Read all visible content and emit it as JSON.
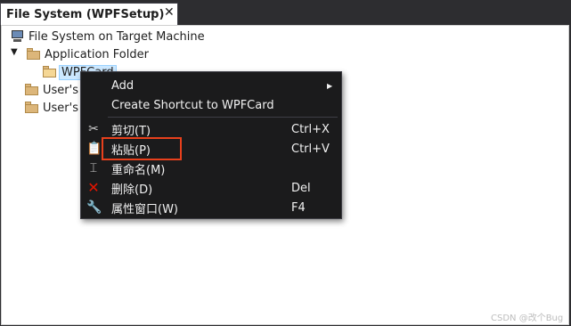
{
  "panel": {
    "title": "File System (WPFSetup)",
    "pin_glyph": "⊸",
    "close_glyph": "✕"
  },
  "tree": {
    "root": "File System on Target Machine",
    "app_folder": "Application Folder",
    "selected_item": "WPFCard",
    "user_folder_1": "User's",
    "user_folder_2": "User's"
  },
  "context_menu": {
    "items": [
      {
        "label": "Add",
        "shortcut": "",
        "icon": "none",
        "submenu": true
      },
      {
        "label": "Create Shortcut to WPFCard",
        "shortcut": "",
        "icon": "none"
      },
      {
        "label": "剪切(T)",
        "shortcut": "Ctrl+X",
        "icon": "scissors-icon"
      },
      {
        "label": "粘贴(P)",
        "shortcut": "Ctrl+V",
        "icon": "paste-icon"
      },
      {
        "label": "重命名(M)",
        "shortcut": "",
        "icon": "rename-icon"
      },
      {
        "label": "删除(D)",
        "shortcut": "Del",
        "icon": "delete-icon"
      },
      {
        "label": "属性窗口(W)",
        "shortcut": "F4",
        "icon": "wrench-icon"
      }
    ],
    "submenu_arrow": "▶"
  },
  "highlight_color": "#e8401c",
  "watermark": "CSDN @改个Bug"
}
